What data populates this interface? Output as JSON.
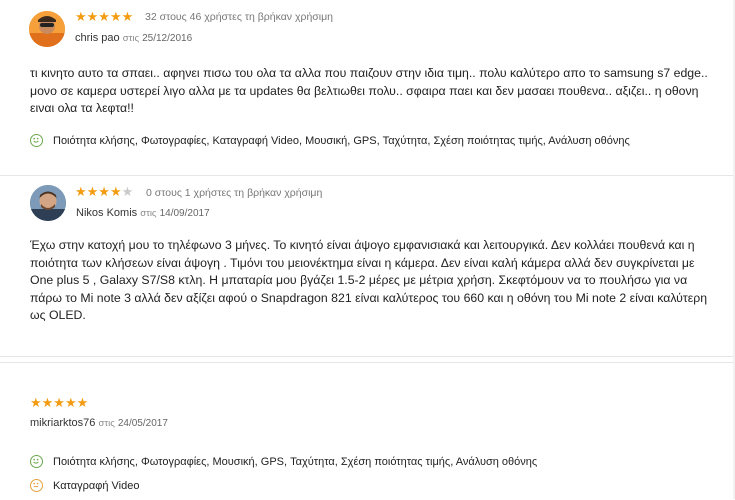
{
  "reviews": [
    {
      "author_first": "chris",
      "author_last": "pao",
      "on_label": "στις",
      "date": "25/12/2016",
      "rating": 5,
      "helpful": "32 στους 46 χρήστες τη βρήκαν χρήσιμη",
      "text": "τι κινητο αυτο τα σπαει.. αφηνει πισω του ολα τα αλλα που παιζουν στην ιδια τιμη.. πολυ καλύτερο απο το samsung s7 edge.. μονο σε καμερα υστερεί λιγο αλλα με τα updates θα βελτιωθει πολυ.. σφαιρα παει και δεν μασαει πουθενα.. αξιζει.. η οθονη ειναι ολα τα λεφτα!!",
      "pros": "Ποιότητα κλήσης, Φωτογραφίες, Καταγραφή Video, Μουσική, GPS, Ταχύτητα, Σχέση ποιότητας τιμής, Ανάλυση οθόνης"
    },
    {
      "author_first": "Nikos",
      "author_last": "Komis",
      "on_label": "στις",
      "date": "14/09/2017",
      "rating": 4,
      "helpful": "0 στους 1 χρήστες τη βρήκαν χρήσιμη",
      "text": "Έχω στην κατοχή μου το τηλέφωνο 3 μήνες. Το κινητό είναι άψογο εμφανισιακά και λειτουργικά. Δεν κολλάει πουθενά και η ποιότητα των κλήσεων είναι άψογη . Τιμόνι του μειονέκτημα είναι η κάμερα. Δεν είναι καλή κάμερα αλλά δεν συγκρίνεται με One plus 5 , Galaxy S7/S8 κτλη. Η μπαταρία μου βγάζει 1.5-2 μέρες με μέτρια χρήση. Σκεφτόμουν να το πουλήσω για να πάρω το Mi note 3 αλλά δεν αξίζει αφού ο Snapdragon 821 είναι καλύτερος του 660 και η οθόνη του Mi note 2 είναι καλύτερη ως OLED."
    },
    {
      "author": "mikriarktos76",
      "on_label": "στις",
      "date": "24/05/2017",
      "rating": 5,
      "pros": "Ποιότητα κλήσης, Φωτογραφίες, Μουσική, GPS, Ταχύτητα, Σχέση ποιότητας τιμής, Ανάλυση οθόνης",
      "neutral": "Καταγραφή Video"
    }
  ],
  "colors": {
    "star": "#f39c12",
    "star_empty": "#c9c9c9",
    "positive": "#6aa84f",
    "neutral": "#e6a23c"
  }
}
